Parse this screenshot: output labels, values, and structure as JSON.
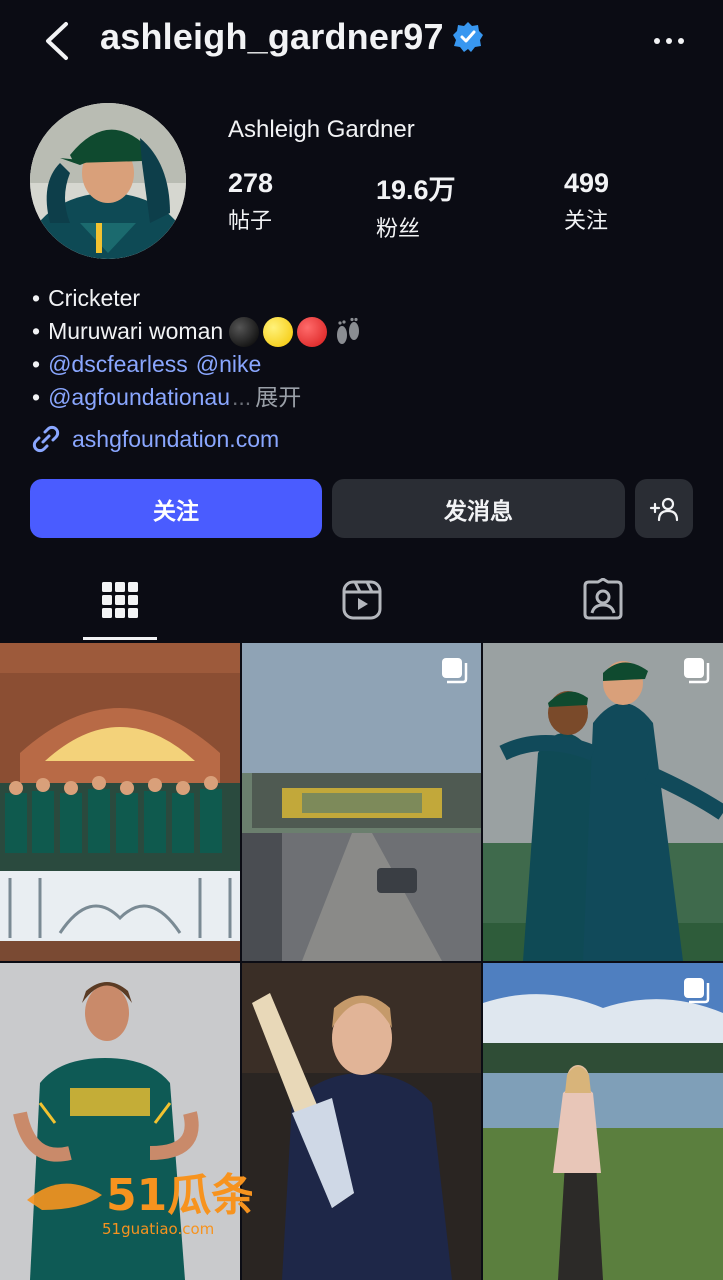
{
  "header": {
    "username": "ashleigh_gardner97"
  },
  "profile": {
    "display_name": "Ashleigh Gardner",
    "stats": [
      {
        "value": "278",
        "label": "帖子"
      },
      {
        "value": "19.6万",
        "label": "粉丝"
      },
      {
        "value": "499",
        "label": "关注"
      }
    ]
  },
  "bio": {
    "bullet": "•",
    "line1": "Cricketer",
    "line2": "Muruwari woman",
    "line3_mention1": "@dscfearless",
    "line3_mention2": "@nike",
    "line4_mention": "@agfoundationau",
    "line4_dots": "...",
    "more_label": "展开",
    "link": "ashgfoundation.com"
  },
  "actions": {
    "follow_label": "关注",
    "message_label": "发消息"
  },
  "watermark": {
    "brand": "51瓜条",
    "url": "51guatiao.com"
  },
  "colors": {
    "accent": "#4a5cff",
    "link": "#8aa7ff",
    "verified": "#3897f0",
    "background": "#0b0c14"
  },
  "icons": [
    "back-arrow-icon",
    "verified-badge-icon",
    "more-options-icon",
    "link-icon",
    "add-person-icon",
    "grid-icon",
    "reels-icon",
    "tagged-icon",
    "multi-post-icon"
  ]
}
